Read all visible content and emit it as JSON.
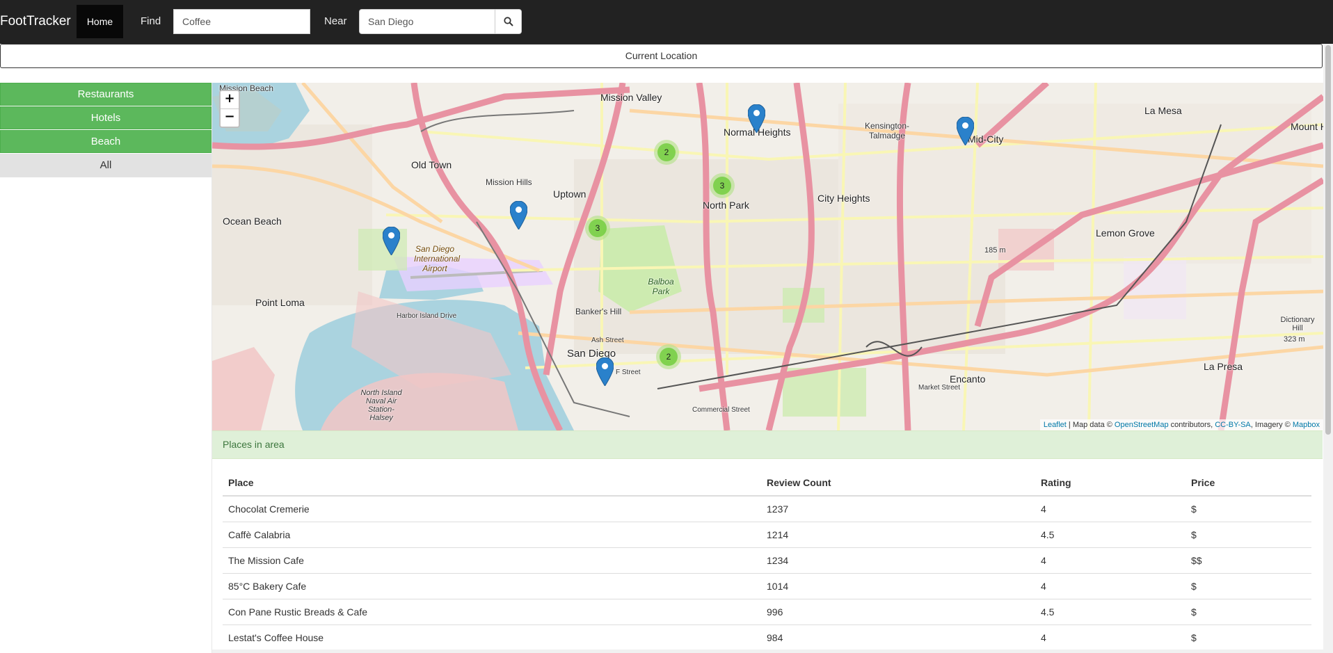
{
  "navbar": {
    "brand": "FootTracker",
    "home_label": "Home",
    "find_label": "Find",
    "find_value": "Coffee",
    "near_label": "Near",
    "near_value": "San Diego",
    "search_icon": "search-icon"
  },
  "current_location_label": "Current Location",
  "sidebar": {
    "items": [
      {
        "label": "Restaurants"
      },
      {
        "label": "Hotels"
      },
      {
        "label": "Beach"
      },
      {
        "label": "All"
      }
    ]
  },
  "map": {
    "zoom_in": "+",
    "zoom_out": "−",
    "labels": [
      "Mission Valley",
      "Normal Heights",
      "Kensington-Talmadge",
      "Mid-City",
      "La Mesa",
      "Mount H",
      "Old Town",
      "Mission Hills",
      "Uptown",
      "North Park",
      "City Heights",
      "Ocean Beach",
      "Lemon Grove",
      "San Diego International Airport",
      "Balboa Park",
      "Point Loma",
      "Banker's Hill",
      "San Diego",
      "Harbor Island Drive",
      "Dictionary Hill",
      "323 m",
      "185 m",
      "Encanto",
      "La Presa",
      "North Island Naval Air Station-Halsey",
      "Mission Beach",
      "Ash Street",
      "F Street",
      "Commercial Street",
      "Market Street"
    ],
    "clusters": [
      {
        "count": "2"
      },
      {
        "count": "3"
      },
      {
        "count": "3"
      },
      {
        "count": "2"
      }
    ],
    "marker_count": 5,
    "attribution": {
      "leaflet": "Leaflet",
      "text1": " | Map data © ",
      "osm": "OpenStreetMap",
      "text2": " contributors, ",
      "license": "CC-BY-SA",
      "text3": ", Imagery © ",
      "mapbox": "Mapbox"
    }
  },
  "places": {
    "heading": "Places in area",
    "columns": [
      "Place",
      "Review Count",
      "Rating",
      "Price"
    ],
    "rows": [
      [
        "Chocolat Cremerie",
        "1237",
        "4",
        "$"
      ],
      [
        "Caffè Calabria",
        "1214",
        "4.5",
        "$"
      ],
      [
        "The Mission Cafe",
        "1234",
        "4",
        "$$"
      ],
      [
        "85°C Bakery Cafe",
        "1014",
        "4",
        "$"
      ],
      [
        "Con Pane Rustic Breads & Cafe",
        "996",
        "4.5",
        "$"
      ],
      [
        "Lestat's Coffee House",
        "984",
        "4",
        "$"
      ]
    ]
  },
  "colors": {
    "navbar": "#222222",
    "success": "#5cb85c",
    "panel_bg": "#dff0d8",
    "marker": "#2a81cb",
    "water": "#aad3df",
    "motorway": "#e892a2"
  }
}
